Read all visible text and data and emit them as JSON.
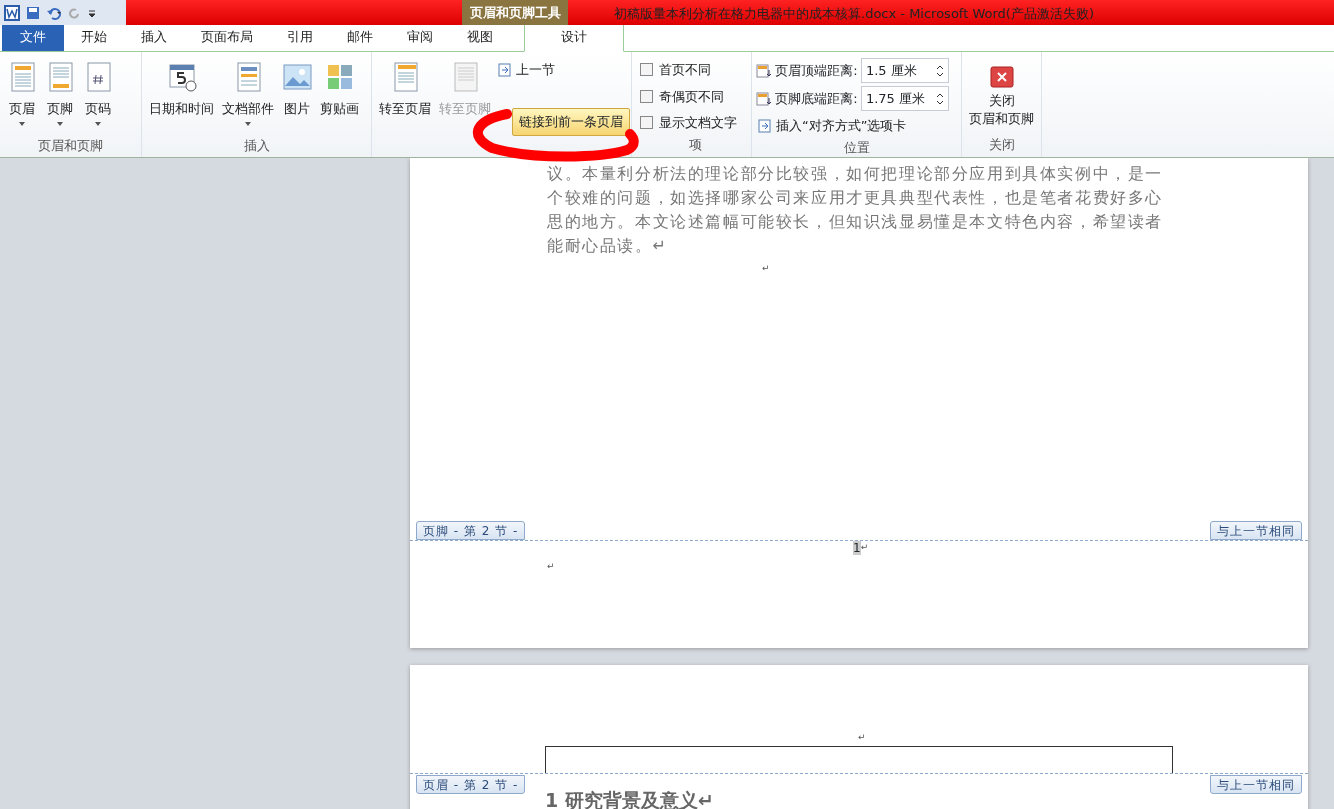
{
  "window_title": "初稿版量本利分析在格力电器中的成本核算.docx - Microsoft Word(产品激活失败)",
  "contextual_tab_group": "页眉和页脚工具",
  "tabs": [
    {
      "label": "文件",
      "kind": "file",
      "selected": false
    },
    {
      "label": "开始",
      "kind": "normal",
      "selected": false
    },
    {
      "label": "插入",
      "kind": "normal",
      "selected": false
    },
    {
      "label": "页面布局",
      "kind": "normal",
      "selected": false
    },
    {
      "label": "引用",
      "kind": "normal",
      "selected": false
    },
    {
      "label": "邮件",
      "kind": "normal",
      "selected": false
    },
    {
      "label": "审阅",
      "kind": "normal",
      "selected": false
    },
    {
      "label": "视图",
      "kind": "normal",
      "selected": false
    },
    {
      "label": "设计",
      "kind": "contextual",
      "selected": true
    }
  ],
  "ribbon_groups": [
    {
      "label": "页眉和页脚",
      "controls": [
        {
          "kind": "large",
          "label": "页眉",
          "dropdown": true,
          "disabled": false
        },
        {
          "kind": "large",
          "label": "页脚",
          "dropdown": true,
          "disabled": false
        },
        {
          "kind": "large",
          "label": "页码",
          "dropdown": true,
          "disabled": false
        }
      ]
    },
    {
      "label": "插入",
      "controls": [
        {
          "kind": "large",
          "label": "日期和时间",
          "dropdown": false,
          "disabled": false
        },
        {
          "kind": "large",
          "label": "文档部件",
          "dropdown": true,
          "disabled": false
        },
        {
          "kind": "large",
          "label": "图片",
          "dropdown": false,
          "disabled": false
        },
        {
          "kind": "large",
          "label": "剪贴画",
          "dropdown": false,
          "disabled": false
        }
      ]
    },
    {
      "controls": [
        {
          "kind": "large",
          "label": "转至页眉",
          "dropdown": false,
          "disabled": false
        },
        {
          "kind": "large",
          "label": "转至页脚",
          "dropdown": false,
          "disabled": true
        },
        {
          "kind": "small",
          "label": "上一节",
          "disabled": false
        }
      ]
    },
    {
      "label": "项",
      "controls": [
        {
          "kind": "check",
          "label": "首页不同",
          "checked": false
        },
        {
          "kind": "check",
          "label": "奇偶页不同",
          "checked": false
        },
        {
          "kind": "check",
          "label": "显示文档文字",
          "checked": false
        }
      ]
    },
    {
      "label": "位置",
      "controls": [
        {
          "kind": "spin",
          "label": "页眉顶端距离:",
          "value": "1.5 厘米"
        },
        {
          "kind": "spin",
          "label": "页脚底端距离:",
          "value": "1.75 厘米"
        },
        {
          "kind": "small",
          "label": "插入“对齐方式”选项卡",
          "disabled": false
        }
      ]
    },
    {
      "label": "关闭",
      "controls": [
        {
          "kind": "close",
          "label": "关闭",
          "label_2": "页眉和页脚"
        }
      ]
    }
  ],
  "tooltip": "链接到前一条页眉",
  "document": {
    "paragraph": "议。本量利分析法的理论部分比较强，如何把理论部分应用到具体实例中，是一个较难的问题，如选择哪家公司来应用才更具典型代表性，也是笔者花费好多心思的地方。本文论述篇幅可能较长，但知识浅显易懂是本文特色内容，希望读者能耐心品读。↵",
    "empty_mark": "↵",
    "footer": {
      "tag": "页脚 - 第 2 节 -",
      "same_as_previous": "与上一节相同",
      "page_number": "1",
      "mark": "↵",
      "line_mark": "↵"
    },
    "header": {
      "mark": "↵",
      "tag": "页眉 - 第 2 节 -",
      "same_as_previous": "与上一节相同"
    },
    "heading": "1 研究背景及意义↵"
  }
}
